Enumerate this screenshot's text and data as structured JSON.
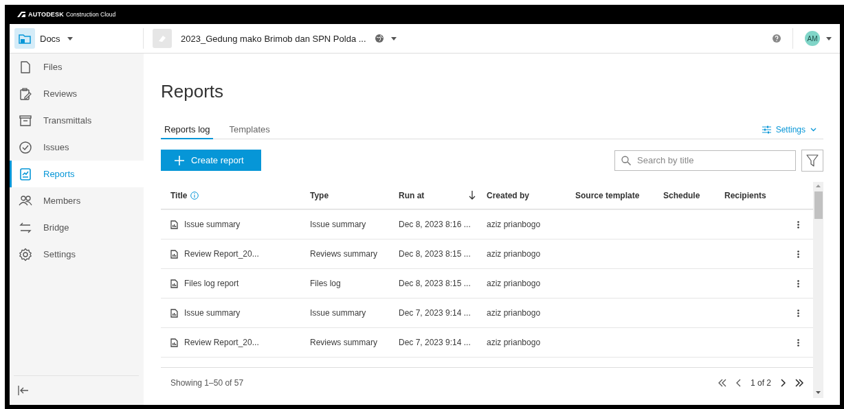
{
  "brand": {
    "name": "AUTODESK",
    "product": "Construction Cloud"
  },
  "header": {
    "app": "Docs",
    "project": "2023_Gedung mako Brimob dan SPN Polda ...",
    "avatar": "AM"
  },
  "sidebar": {
    "items": [
      {
        "label": "Files",
        "selected": false
      },
      {
        "label": "Reviews",
        "selected": false
      },
      {
        "label": "Transmittals",
        "selected": false
      },
      {
        "label": "Issues",
        "selected": false
      },
      {
        "label": "Reports",
        "selected": true
      },
      {
        "label": "Members",
        "selected": false
      },
      {
        "label": "Bridge",
        "selected": false
      },
      {
        "label": "Settings",
        "selected": false
      }
    ]
  },
  "page_title": "Reports",
  "tabs": [
    {
      "label": "Reports log",
      "selected": true
    },
    {
      "label": "Templates",
      "selected": false
    }
  ],
  "settings_label": "Settings",
  "create_button": "Create report",
  "search": {
    "placeholder": "Search by title"
  },
  "table": {
    "columns": [
      {
        "label": "Title",
        "info": true,
        "sorted": false
      },
      {
        "label": "Type",
        "info": false,
        "sorted": false
      },
      {
        "label": "Run at",
        "info": false,
        "sorted": true
      },
      {
        "label": "Created by",
        "info": false,
        "sorted": false
      },
      {
        "label": "Source template",
        "info": false,
        "sorted": false
      },
      {
        "label": "Schedule",
        "info": false,
        "sorted": false
      },
      {
        "label": "Recipients",
        "info": false,
        "sorted": false
      }
    ],
    "rows": [
      {
        "title": "Issue summary",
        "type": "Issue summary",
        "run_at": "Dec 8, 2023 8:16 ...",
        "created_by": "aziz prianbogo"
      },
      {
        "title": "Review Report_20...",
        "type": "Reviews summary",
        "run_at": "Dec 8, 2023 8:15 ...",
        "created_by": "aziz prianbogo"
      },
      {
        "title": "Files log report",
        "type": "Files log",
        "run_at": "Dec 8, 2023 8:15 ...",
        "created_by": "aziz prianbogo"
      },
      {
        "title": "Issue summary",
        "type": "Issue summary",
        "run_at": "Dec 7, 2023 9:14 ...",
        "created_by": "aziz prianbogo"
      },
      {
        "title": "Review Report_20...",
        "type": "Reviews summary",
        "run_at": "Dec 7, 2023 9:14 ...",
        "created_by": "aziz prianbogo"
      }
    ]
  },
  "footer": {
    "showing": "Showing 1–50 of 57",
    "page": "1 of 2"
  }
}
